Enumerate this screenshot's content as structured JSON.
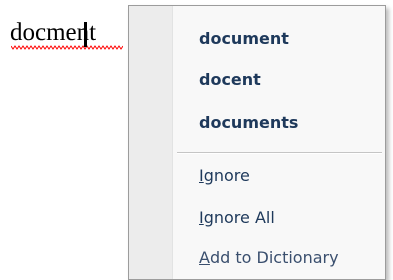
{
  "document": {
    "misspelled_word": "docment"
  },
  "context_menu": {
    "suggestions": [
      {
        "label": "document"
      },
      {
        "label": "docent"
      },
      {
        "label": "documents"
      }
    ],
    "ignore": {
      "accel": "I",
      "rest": "gnore"
    },
    "ignore_all": {
      "accel": "I",
      "rest": "gnore All"
    },
    "add_to_dictionary": {
      "accel": "A",
      "rest": "dd to Dictionary"
    }
  },
  "colors": {
    "menu_text": "#1e395b",
    "squiggle": "#ff0000",
    "menu_background": "#f8f8f8",
    "gutter": "#ececec"
  }
}
